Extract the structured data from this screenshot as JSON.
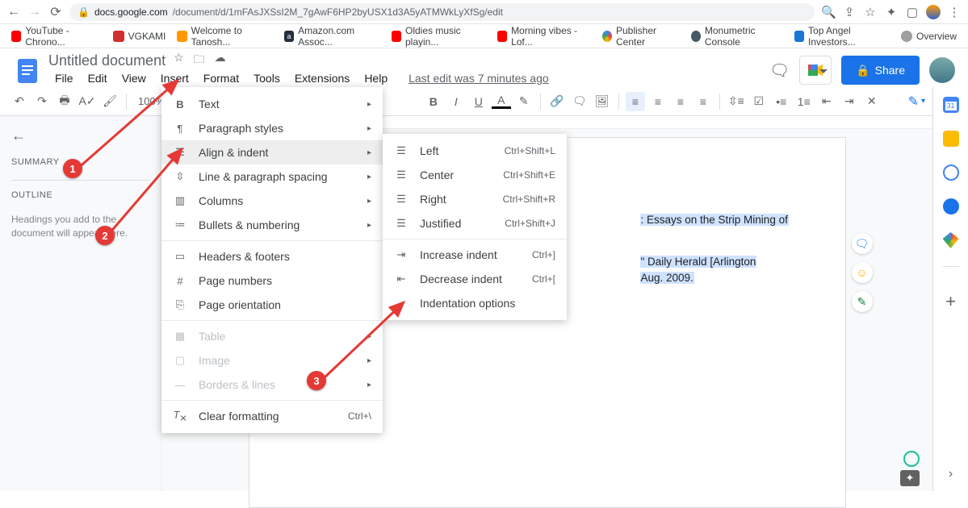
{
  "browser": {
    "url_host": "docs.google.com",
    "url_path": "/document/d/1mFAsJXSsI2M_7gAwF6HP2byUSX1d3A5yATMWkLyXfSg/edit"
  },
  "bookmarks": [
    {
      "label": "YouTube - Chrono...",
      "color": "#ff0000"
    },
    {
      "label": "VGKAMI",
      "color": "#d32f2f"
    },
    {
      "label": "Welcome to Tanosh...",
      "color": "#ff9800"
    },
    {
      "label": "Amazon.com Assoc...",
      "color": "#232f3e"
    },
    {
      "label": "Oldies music playin...",
      "color": "#ff0000"
    },
    {
      "label": "Morning vibes - Lof...",
      "color": "#ff0000"
    },
    {
      "label": "Publisher Center",
      "color": "#4285f4"
    },
    {
      "label": "Monumetric Console",
      "color": "#455a64"
    },
    {
      "label": "Top Angel Investors...",
      "color": "#1976d2"
    },
    {
      "label": "Overview",
      "color": "#9e9e9e"
    }
  ],
  "doc": {
    "title": "Untitled document",
    "menus": [
      "File",
      "Edit",
      "View",
      "Insert",
      "Format",
      "Tools",
      "Extensions",
      "Help"
    ],
    "last_edit": "Last edit was 7 minutes ago",
    "share": "Share",
    "zoom": "100%"
  },
  "outline": {
    "summary": "SUMMARY",
    "outline": "OUTLINE",
    "empty": "Headings you add to the document will appear here."
  },
  "format_menu": [
    {
      "icon": "B",
      "label": "Text",
      "arrow": true
    },
    {
      "icon": "¶",
      "label": "Paragraph styles",
      "arrow": true
    },
    {
      "icon": "≡",
      "label": "Align & indent",
      "arrow": true,
      "hl": true
    },
    {
      "icon": "≡",
      "label": "Line & paragraph spacing",
      "arrow": true
    },
    {
      "icon": "▥",
      "label": "Columns",
      "arrow": true
    },
    {
      "icon": "≔",
      "label": "Bullets & numbering",
      "arrow": true
    },
    {
      "sep": true
    },
    {
      "icon": "▭",
      "label": "Headers & footers"
    },
    {
      "icon": "#",
      "label": "Page numbers"
    },
    {
      "icon": "⎘",
      "label": "Page orientation"
    },
    {
      "sep": true
    },
    {
      "icon": "▦",
      "label": "Table",
      "arrow": true,
      "dis": true
    },
    {
      "icon": "▢",
      "label": "Image",
      "arrow": true,
      "dis": true
    },
    {
      "icon": "—",
      "label": "Borders & lines",
      "arrow": true,
      "dis": true
    },
    {
      "sep": true
    },
    {
      "icon": "✕",
      "label": "Clear formatting",
      "shortcut": "Ctrl+\\"
    }
  ],
  "align_submenu": [
    {
      "icon": "≡",
      "label": "Left",
      "shortcut": "Ctrl+Shift+L"
    },
    {
      "icon": "≡",
      "label": "Center",
      "shortcut": "Ctrl+Shift+E"
    },
    {
      "icon": "≡",
      "label": "Right",
      "shortcut": "Ctrl+Shift+R"
    },
    {
      "icon": "≡",
      "label": "Justified",
      "shortcut": "Ctrl+Shift+J"
    },
    {
      "sep": true
    },
    {
      "icon": "⇥",
      "label": "Increase indent",
      "shortcut": "Ctrl+]"
    },
    {
      "icon": "⇤",
      "label": "Decrease indent",
      "shortcut": "Ctrl+["
    },
    {
      "icon": "",
      "label": "Indentation options"
    }
  ],
  "doc_text": {
    "l1": ": Essays on the Strip Mining of",
    "l2": "\" Daily Herald [Arlington",
    "l3": "Aug. 2009."
  },
  "anno": {
    "a1": "1",
    "a2": "2",
    "a3": "3"
  }
}
